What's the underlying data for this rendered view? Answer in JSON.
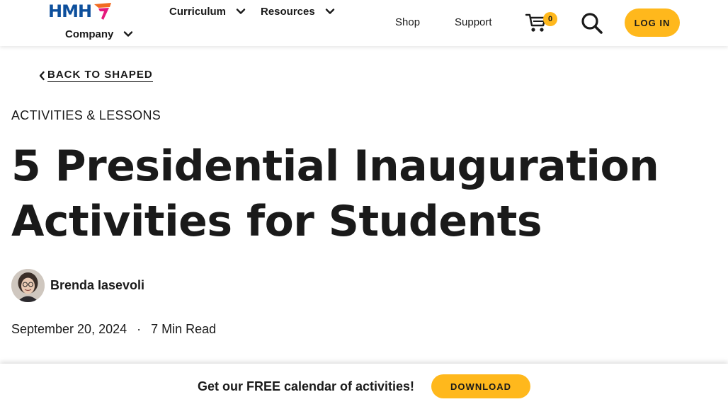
{
  "header": {
    "logo_text": "HMH",
    "nav": {
      "curriculum": "Curriculum",
      "resources": "Resources",
      "company": "Company",
      "shop": "Shop",
      "support": "Support"
    },
    "cart_count": "0",
    "login_label": "LOG IN"
  },
  "article": {
    "back_label": "BACK TO SHAPED",
    "category": "ACTIVITIES & LESSONS",
    "title": "5 Presidential Inauguration Activities for Students",
    "author": "Brenda Iasevoli",
    "date": "September 20, 2024",
    "separator": "·",
    "read_time": "7 Min Read"
  },
  "promo": {
    "text": "Get our FREE calendar of activities!",
    "button_label": "DOWNLOAD"
  },
  "icons": {
    "logo_mark": "hmh-logo-mark",
    "chevron": "chevron-down-icon",
    "cart": "cart-icon",
    "search": "search-icon",
    "back": "chevron-left-icon"
  },
  "colors": {
    "accent": "#ffb81c",
    "logo_blue": "#0d4f9c",
    "logo_pink": "#e5197d",
    "logo_orange": "#f26b21",
    "text": "#1a1a1a"
  }
}
